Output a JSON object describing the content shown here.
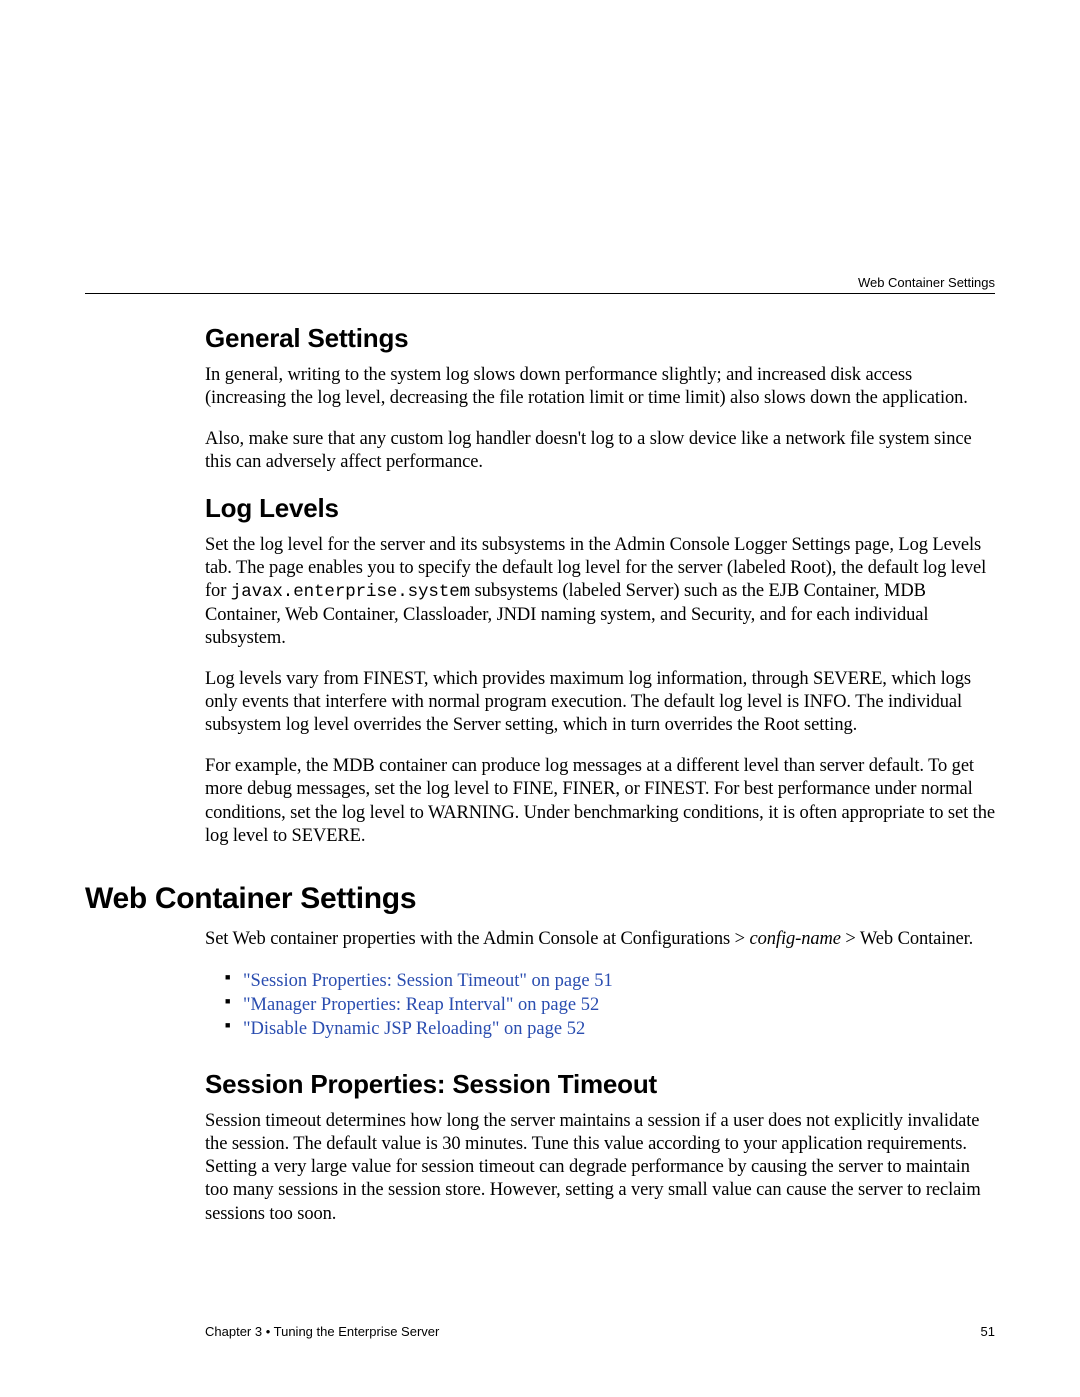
{
  "header": {
    "running_title": "Web Container Settings"
  },
  "sections": {
    "general_settings": {
      "heading": "General Settings",
      "p1": "In general, writing to the system log slows down performance slightly; and increased disk access (increasing the log level, decreasing the file rotation limit or time limit) also slows down the application.",
      "p2": "Also, make sure that any custom log handler doesn't log to a slow device like a network file system since this can adversely affect performance."
    },
    "log_levels": {
      "heading": "Log Levels",
      "p1_pre": "Set the log level for the server and its subsystems in the Admin Console Logger Settings page, Log Levels tab. The page enables you to specify the default log level for the server (labeled Root), the default log level for ",
      "p1_code": "javax.enterprise.system",
      "p1_post": " subsystems (labeled Server) such as the EJB Container, MDB Container, Web Container, Classloader, JNDI naming system, and Security, and for each individual subsystem.",
      "p2": "Log levels vary from FINEST, which provides maximum log information, through SEVERE, which logs only events that interfere with normal program execution. The default log level is INFO. The individual subsystem log level overrides the Server setting, which in turn overrides the Root setting.",
      "p3": "For example, the MDB container can produce log messages at a different level than server default. To get more debug messages, set the log level to FINE, FINER, or FINEST. For best performance under normal conditions, set the log level to WARNING. Under benchmarking conditions, it is often appropriate to set the log level to SEVERE."
    },
    "web_container": {
      "heading": "Web Container Settings",
      "intro_pre": "Set Web container properties with the Admin Console at Configurations > ",
      "intro_italic": "config-name",
      "intro_post": " > Web Container.",
      "links": [
        "\"Session Properties: Session Timeout\" on page 51",
        "\"Manager Properties: Reap Interval\" on page 52",
        "\"Disable Dynamic JSP Reloading\" on page 52"
      ]
    },
    "session_timeout": {
      "heading": "Session Properties: Session Timeout",
      "p1": "Session timeout determines how long the server maintains a session if a user does not explicitly invalidate the session. The default value is 30 minutes. Tune this value according to your application requirements. Setting a very large value for session timeout can degrade performance by causing the server to maintain too many sessions in the session store. However, setting a very small value can cause the server to reclaim sessions too soon."
    }
  },
  "footer": {
    "left": "Chapter 3  •  Tuning the Enterprise Server",
    "page": "51"
  }
}
